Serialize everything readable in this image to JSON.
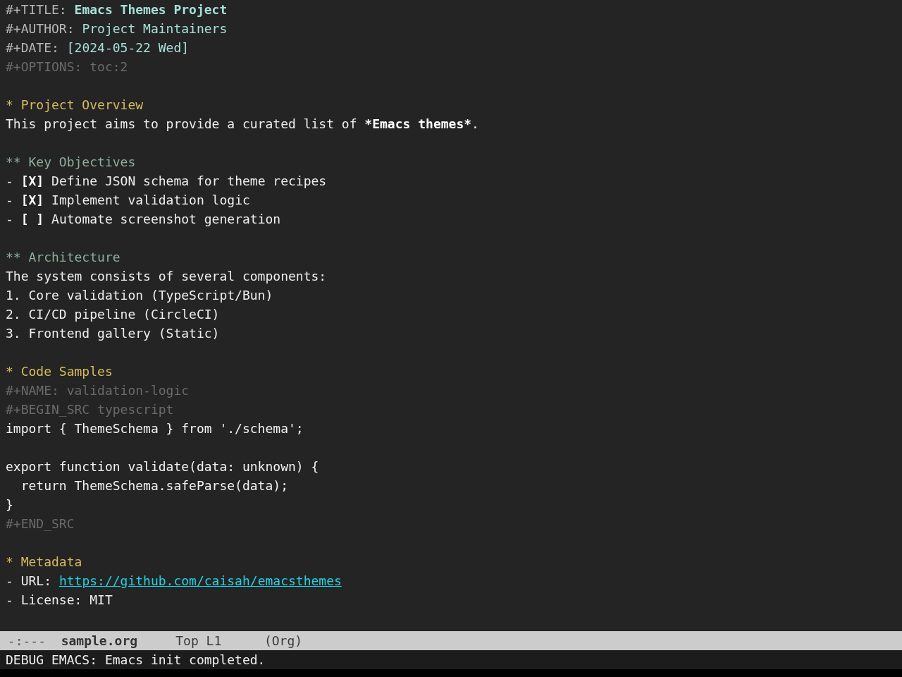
{
  "buffer": {
    "keywords": [
      {
        "kind": "title",
        "key": "#+TITLE:",
        "value": "Emacs Themes Project"
      },
      {
        "kind": "info",
        "key": "#+AUTHOR:",
        "value": "Project Maintainers"
      },
      {
        "kind": "info",
        "key": "#+DATE:",
        "value": "[2024-05-22 Wed]"
      },
      {
        "kind": "setting",
        "key": "#+OPTIONS:",
        "value": "toc:2"
      }
    ],
    "sections": [
      {
        "stars": "*",
        "title": "Project Overview",
        "body": [
          {
            "kind": "paragraph",
            "segments": [
              {
                "text": "This project aims to provide a curated list of ",
                "bold": false
              },
              {
                "text": "*Emacs themes*",
                "bold": true
              },
              {
                "text": ".",
                "bold": false
              }
            ]
          }
        ],
        "children": [
          {
            "stars": "**",
            "title": "Key Objectives",
            "body": [
              {
                "kind": "checklist",
                "items": [
                  {
                    "bullet": "-",
                    "box": "[X]",
                    "text": "Define JSON schema for theme recipes"
                  },
                  {
                    "bullet": "-",
                    "box": "[X]",
                    "text": "Implement validation logic"
                  },
                  {
                    "bullet": "-",
                    "box": "[ ]",
                    "text": "Automate screenshot generation"
                  }
                ]
              }
            ]
          },
          {
            "stars": "**",
            "title": "Architecture",
            "body": [
              {
                "kind": "paragraph",
                "segments": [
                  {
                    "text": "The system consists of several components:",
                    "bold": false
                  }
                ]
              },
              {
                "kind": "numbered",
                "items": [
                  {
                    "number": "1.",
                    "text": "Core validation (TypeScript/Bun)"
                  },
                  {
                    "number": "2.",
                    "text": "CI/CD pipeline (CircleCI)"
                  },
                  {
                    "number": "3.",
                    "text": "Frontend gallery (Static)"
                  }
                ]
              }
            ]
          }
        ]
      },
      {
        "stars": "*",
        "title": "Code Samples",
        "body": [
          {
            "kind": "src",
            "name_line": "#+NAME: validation-logic",
            "begin_line": "#+BEGIN_SRC typescript",
            "code": "import { ThemeSchema } from './schema';\n\nexport function validate(data: unknown) {\n  return ThemeSchema.safeParse(data);\n}",
            "end_line": "#+END_SRC"
          }
        ]
      },
      {
        "stars": "*",
        "title": "Metadata",
        "body": [
          {
            "kind": "bullets",
            "items": [
              {
                "bullet": "-",
                "label": "URL:",
                "link": "https://github.com/caisah/emacsthemes"
              },
              {
                "bullet": "-",
                "label": "License:",
                "value": "MIT"
              }
            ]
          }
        ]
      }
    ]
  },
  "mode_line": {
    "status": "-:---",
    "buffer_name": "sample.org",
    "position": "Top L1",
    "mode": "(Org)"
  },
  "echo_area": {
    "message": "DEBUG EMACS: Emacs init completed."
  }
}
